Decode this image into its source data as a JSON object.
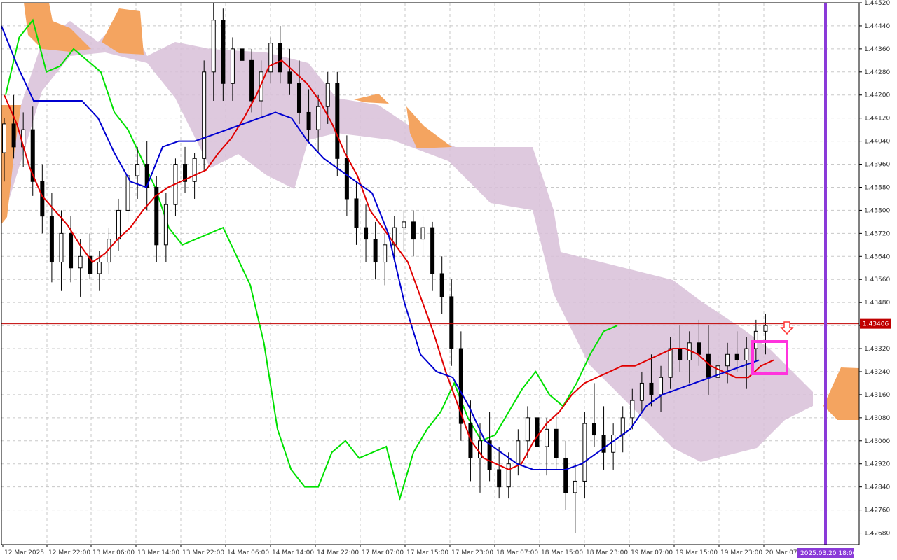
{
  "chart_data": {
    "type": "candlestick",
    "indicator": "ichimoku",
    "y_axis": {
      "min": 1.4264,
      "max": 1.4452,
      "ticks": [
        "1.44520",
        "1.44440",
        "1.44360",
        "1.44280",
        "1.44200",
        "1.44120",
        "1.44040",
        "1.43960",
        "1.43880",
        "1.43800",
        "1.43720",
        "1.43640",
        "1.43560",
        "1.43480",
        "1.43400",
        "1.43320",
        "1.43240",
        "1.43160",
        "1.43080",
        "1.43000",
        "1.42920",
        "1.42840",
        "1.42760",
        "1.42680"
      ]
    },
    "x_axis": {
      "labels": [
        "12 Mar 2025",
        "12 Mar 22:00",
        "13 Mar 06:00",
        "13 Mar 14:00",
        "13 Mar 22:00",
        "14 Mar 06:00",
        "14 Mar 14:00",
        "14 Mar 22:00",
        "17 Mar 07:00",
        "17 Mar 15:00",
        "17 Mar 23:00",
        "18 Mar 07:00",
        "18 Mar 15:00",
        "18 Mar 23:00",
        "19 Mar 07:00",
        "19 Mar 15:00",
        "19 Mar 23:00",
        "20 Mar 07:00"
      ],
      "current_time_label": "2025.03.20 18:00"
    },
    "current_price": {
      "value": 1.43406,
      "label": "1.43406"
    },
    "candles": [
      [
        1.44,
        1.4412,
        1.439,
        1.441
      ],
      [
        1.441,
        1.442,
        1.4398,
        1.4402
      ],
      [
        1.4402,
        1.4414,
        1.4395,
        1.4408
      ],
      [
        1.4408,
        1.4416,
        1.4385,
        1.439
      ],
      [
        1.439,
        1.4396,
        1.4372,
        1.4378
      ],
      [
        1.4378,
        1.4386,
        1.4355,
        1.4362
      ],
      [
        1.4362,
        1.438,
        1.4352,
        1.4372
      ],
      [
        1.4372,
        1.4378,
        1.4355,
        1.436
      ],
      [
        1.436,
        1.437,
        1.435,
        1.4364
      ],
      [
        1.4364,
        1.4372,
        1.4356,
        1.4358
      ],
      [
        1.4358,
        1.4366,
        1.4352,
        1.4362
      ],
      [
        1.4362,
        1.4374,
        1.4358,
        1.437
      ],
      [
        1.437,
        1.4384,
        1.4366,
        1.438
      ],
      [
        1.438,
        1.4396,
        1.4376,
        1.4392
      ],
      [
        1.4392,
        1.4402,
        1.4384,
        1.4396
      ],
      [
        1.4396,
        1.4404,
        1.438,
        1.4388
      ],
      [
        1.4388,
        1.4392,
        1.4362,
        1.4368
      ],
      [
        1.4368,
        1.4386,
        1.4362,
        1.4382
      ],
      [
        1.4382,
        1.4398,
        1.4378,
        1.4396
      ],
      [
        1.4396,
        1.4402,
        1.4386,
        1.439
      ],
      [
        1.439,
        1.44,
        1.4384,
        1.4398
      ],
      [
        1.4398,
        1.4432,
        1.4394,
        1.4428
      ],
      [
        1.4428,
        1.4452,
        1.4418,
        1.4446
      ],
      [
        1.4446,
        1.445,
        1.4418,
        1.4424
      ],
      [
        1.4424,
        1.444,
        1.4418,
        1.4436
      ],
      [
        1.4436,
        1.4442,
        1.4424,
        1.4432
      ],
      [
        1.4432,
        1.4436,
        1.4414,
        1.4418
      ],
      [
        1.4418,
        1.4432,
        1.4412,
        1.4428
      ],
      [
        1.4428,
        1.444,
        1.4424,
        1.4438
      ],
      [
        1.4438,
        1.4444,
        1.4424,
        1.4428
      ],
      [
        1.4428,
        1.4436,
        1.442,
        1.4424
      ],
      [
        1.4424,
        1.4432,
        1.441,
        1.4414
      ],
      [
        1.4414,
        1.4422,
        1.4404,
        1.4408
      ],
      [
        1.4408,
        1.442,
        1.44,
        1.4416
      ],
      [
        1.4416,
        1.4428,
        1.441,
        1.4424
      ],
      [
        1.4424,
        1.4428,
        1.4392,
        1.4398
      ],
      [
        1.4398,
        1.4406,
        1.4378,
        1.4384
      ],
      [
        1.4384,
        1.439,
        1.4368,
        1.4374
      ],
      [
        1.4374,
        1.4382,
        1.4362,
        1.437
      ],
      [
        1.437,
        1.4376,
        1.4356,
        1.4362
      ],
      [
        1.4362,
        1.4372,
        1.4354,
        1.4368
      ],
      [
        1.4368,
        1.4378,
        1.4362,
        1.4374
      ],
      [
        1.4374,
        1.438,
        1.4366,
        1.4376
      ],
      [
        1.4376,
        1.438,
        1.4364,
        1.437
      ],
      [
        1.437,
        1.4378,
        1.4364,
        1.4374
      ],
      [
        1.4374,
        1.4376,
        1.4352,
        1.4358
      ],
      [
        1.4358,
        1.4364,
        1.4344,
        1.435
      ],
      [
        1.435,
        1.4356,
        1.4326,
        1.4332
      ],
      [
        1.4332,
        1.4338,
        1.43,
        1.4306
      ],
      [
        1.4306,
        1.4314,
        1.4286,
        1.4294
      ],
      [
        1.4294,
        1.4306,
        1.4282,
        1.43
      ],
      [
        1.43,
        1.431,
        1.4286,
        1.429
      ],
      [
        1.429,
        1.4298,
        1.428,
        1.4284
      ],
      [
        1.4284,
        1.4296,
        1.428,
        1.4292
      ],
      [
        1.4292,
        1.4304,
        1.4288,
        1.43
      ],
      [
        1.43,
        1.4312,
        1.4294,
        1.4308
      ],
      [
        1.4308,
        1.4312,
        1.4294,
        1.4298
      ],
      [
        1.4298,
        1.4308,
        1.4288,
        1.4304
      ],
      [
        1.4304,
        1.431,
        1.429,
        1.4294
      ],
      [
        1.4294,
        1.43,
        1.4276,
        1.4282
      ],
      [
        1.4282,
        1.4292,
        1.4268,
        1.4286
      ],
      [
        1.4286,
        1.431,
        1.428,
        1.4306
      ],
      [
        1.4306,
        1.432,
        1.4298,
        1.4302
      ],
      [
        1.4302,
        1.4312,
        1.429,
        1.4296
      ],
      [
        1.4296,
        1.4306,
        1.429,
        1.4302
      ],
      [
        1.4302,
        1.4312,
        1.4296,
        1.4308
      ],
      [
        1.4308,
        1.4318,
        1.4304,
        1.4314
      ],
      [
        1.4314,
        1.4324,
        1.431,
        1.432
      ],
      [
        1.432,
        1.433,
        1.4312,
        1.4316
      ],
      [
        1.4316,
        1.4326,
        1.431,
        1.4322
      ],
      [
        1.4322,
        1.4336,
        1.4318,
        1.4332
      ],
      [
        1.4332,
        1.434,
        1.4324,
        1.4328
      ],
      [
        1.4328,
        1.4338,
        1.432,
        1.4334
      ],
      [
        1.4334,
        1.4342,
        1.4326,
        1.433
      ],
      [
        1.433,
        1.434,
        1.4316,
        1.4322
      ],
      [
        1.4322,
        1.433,
        1.4314,
        1.4326
      ],
      [
        1.4326,
        1.4334,
        1.432,
        1.433
      ],
      [
        1.433,
        1.4338,
        1.4324,
        1.4328
      ],
      [
        1.4328,
        1.4336,
        1.4318,
        1.4332
      ],
      [
        1.4332,
        1.4342,
        1.4328,
        1.4338
      ],
      [
        1.4338,
        1.4344,
        1.433,
        1.434
      ]
    ],
    "tenkan": [
      1.442,
      1.441,
      1.4395,
      1.4385,
      1.438,
      1.4375,
      1.4368,
      1.4362,
      1.4365,
      1.437,
      1.4374,
      1.438,
      1.4385,
      1.4388,
      1.439,
      1.4392,
      1.4394,
      1.44,
      1.4405,
      1.4412,
      1.442,
      1.443,
      1.4432,
      1.4428,
      1.4424,
      1.4418,
      1.441,
      1.44,
      1.4392,
      1.438,
      1.4374,
      1.4368,
      1.4362,
      1.435,
      1.4338,
      1.4324,
      1.4312,
      1.43,
      1.4294,
      1.4292,
      1.429,
      1.4292,
      1.43,
      1.4306,
      1.431,
      1.4316,
      1.432,
      1.4322,
      1.4324,
      1.4326,
      1.4326,
      1.4328,
      1.433,
      1.4332,
      1.4332,
      1.433,
      1.4326,
      1.4324,
      1.4322,
      1.4322,
      1.4326,
      1.4328
    ],
    "kijun": [
      1.4444,
      1.443,
      1.4418,
      1.4418,
      1.4418,
      1.4418,
      1.4412,
      1.44,
      1.439,
      1.4388,
      1.4402,
      1.4404,
      1.4404,
      1.4406,
      1.4408,
      1.441,
      1.4412,
      1.4414,
      1.4412,
      1.4404,
      1.4398,
      1.4394,
      1.439,
      1.4386,
      1.4372,
      1.4348,
      1.433,
      1.4324,
      1.4322,
      1.4312,
      1.43,
      1.4296,
      1.4292,
      1.429,
      1.429,
      1.429,
      1.4292,
      1.4296,
      1.43,
      1.4304,
      1.4312,
      1.4316,
      1.4318,
      1.432,
      1.4322,
      1.4324,
      1.4326,
      1.4328
    ],
    "chikou": [
      1.442,
      1.444,
      1.4446,
      1.4428,
      1.443,
      1.4436,
      1.4432,
      1.4428,
      1.4414,
      1.4408,
      1.4398,
      1.4388,
      1.4374,
      1.4368,
      1.437,
      1.4372,
      1.4374,
      1.4364,
      1.4354,
      1.4334,
      1.4304,
      1.429,
      1.4284,
      1.4284,
      1.4296,
      1.43,
      1.4294,
      1.4296,
      1.4298,
      1.428,
      1.4296,
      1.4304,
      1.431,
      1.432,
      1.4308,
      1.43,
      1.4302,
      1.431,
      1.4318,
      1.4324,
      1.4316,
      1.4312,
      1.432,
      1.433,
      1.4338,
      1.434
    ],
    "cloud_colors": {
      "bullish": "#f4a460",
      "bearish": "#d8bfd8"
    },
    "colors": {
      "candle_up_fill": "#ffffff",
      "candle_down_fill": "#000000",
      "candle_wick": "#000000",
      "tenkan": "#e00000",
      "kijun": "#0000d0",
      "chikou": "#00e000",
      "price_line": "#c00000",
      "vertical_marker": "#8a3ad8",
      "highlight_box": "#ff33dd",
      "arrow": "#ff3333"
    }
  }
}
